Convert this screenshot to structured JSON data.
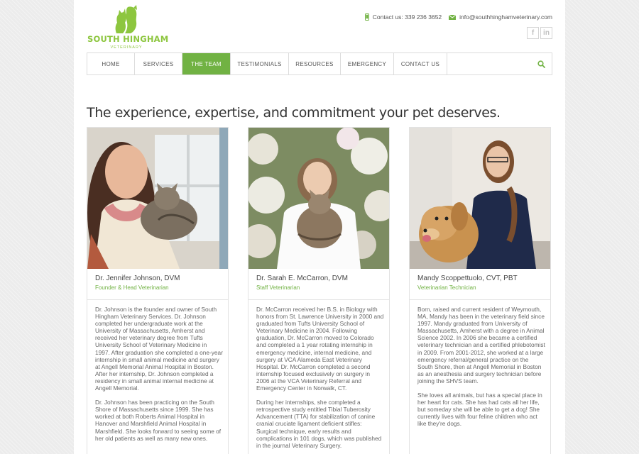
{
  "brand": {
    "name": "SOUTH HINGHAM",
    "sub": "VETERINARY",
    "color": "#8dc63f"
  },
  "contact": {
    "phone": "Contact us: 339 236 3652",
    "email": "info@southhinghamveterinary.com"
  },
  "social": [
    {
      "icon": "facebook-icon",
      "glyph": "f"
    },
    {
      "icon": "linkedin-icon",
      "glyph": "in"
    }
  ],
  "nav": {
    "items": [
      {
        "label": "HOME",
        "active": false
      },
      {
        "label": "SERVICES",
        "active": false
      },
      {
        "label": "THE TEAM",
        "active": true
      },
      {
        "label": "TESTIMONIALS",
        "active": false
      },
      {
        "label": "RESOURCES",
        "active": false
      },
      {
        "label": "EMERGENCY",
        "active": false
      },
      {
        "label": "CONTACT US",
        "active": false
      }
    ],
    "search_icon": "search-icon",
    "accent": "#71b243"
  },
  "tagline": "The experience, expertise, and commitment your pet deserves.",
  "team": [
    {
      "name": "Dr. Jennifer Johnson, DVM",
      "role": "Founder & Head Veterinarian",
      "bio": [
        "Dr. Johnson is the founder and owner of South Hingham Veterinary Services. Dr. Johnson completed her undergraduate work at the University of Massachusetts, Amherst and received her veterinary degree from Tufts University School of Veterinary Medicine in 1997. After graduation she completed a one-year internship in small animal medicine and surgery at Angell Memorial Animal Hospital in Boston. After her internship, Dr. Johnson completed a residency in small animal internal medicine at Angell Memorial.",
        "Dr. Johnson has been practicing on the South Shore of Massachusetts since 1999. She has worked at both Roberts Animal Hospital in Hanover and Marshfield Animal Hospital in Marshfield. She looks forward to seeing some of her old patients as well as many new ones."
      ]
    },
    {
      "name": "Dr. Sarah E. McCarron, DVM",
      "role": "Staff Veterinarian",
      "bio": [
        "Dr. McCarron received her B.S. in Biology with honors from St. Lawrence University in 2000 and graduated from Tufts University School of Veterinary Medicine in 2004. Following graduation, Dr. McCarron moved to Colorado and completed a 1 year rotating internship in emergency medicine, internal medicine, and surgery at VCA Alameda East Veterinary Hospital. Dr. McCarron completed a second internship focused exclusively on surgery in 2006 at the VCA Veterinary Referral and Emergency Center in Norwalk, CT.",
        "During her internships, she completed a retrospective study entitled Tibial Tuberosity Advancement (TTA) for stabilization of canine cranial cruciate ligament deficient stifles: Surgical technique, early results and complications in 101 dogs, which was published in the journal Veterinary Surgery."
      ]
    },
    {
      "name": "Mandy Scoppettuolo, CVT, PBT",
      "role": "Veterinarian Technician",
      "bio": [
        "Born, raised and current resident of Weymouth, MA, Mandy has been in the veterinary field since 1997. Mandy graduated from University of Massachusetts, Amherst with a degree in Animal Science 2002. In 2006 she became a certified veterinary technician and a certified phlebotomist in 2009. From 2001-2012, she worked at a large emergency referral/general practice on the South Shore, then at Angell Memorial in Boston as an anesthesia and surgery technician before joining the SHVS team.",
        "She loves all animals, but has a special place in her heart for cats. She has had cats all her life, but someday she will be able to get a dog! She currently lives with four feline children who act like they're dogs."
      ]
    }
  ]
}
